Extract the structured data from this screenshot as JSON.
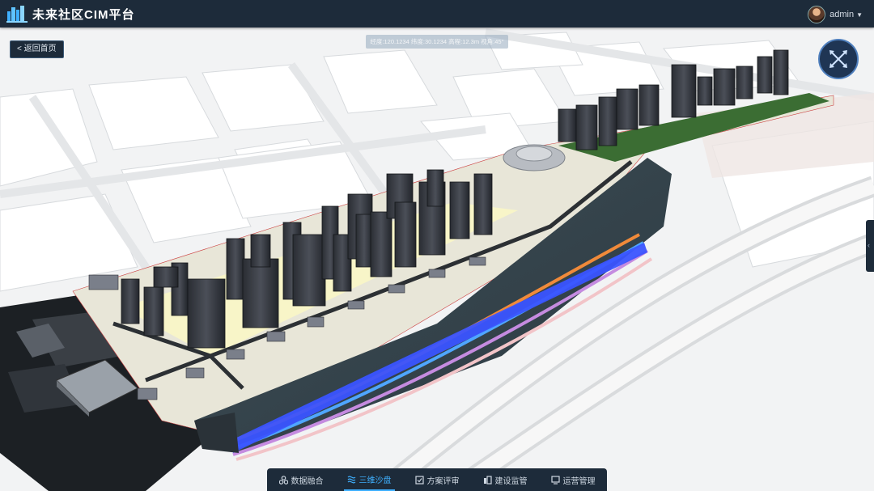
{
  "app": {
    "title": "未来社区CIM平台"
  },
  "user": {
    "name": "admin"
  },
  "nav": {
    "back_label": "< 返回首页"
  },
  "status_strip": {
    "text": "经度:120.1234  纬度:30.1234  高程:12.3m  视角:45°"
  },
  "toolbar": {
    "items": [
      {
        "label": "数据融合",
        "icon": "data-fusion-icon",
        "active": false
      },
      {
        "label": "三维沙盘",
        "icon": "3d-sandbox-icon",
        "active": true
      },
      {
        "label": "方案评审",
        "icon": "plan-review-icon",
        "active": false
      },
      {
        "label": "建设监管",
        "icon": "construction-icon",
        "active": false
      },
      {
        "label": "运营管理",
        "icon": "operation-icon",
        "active": false
      }
    ]
  },
  "colors": {
    "topbar": "#1d2b3a",
    "accent": "#3fb0ff",
    "compass": "#4f7fbd"
  }
}
